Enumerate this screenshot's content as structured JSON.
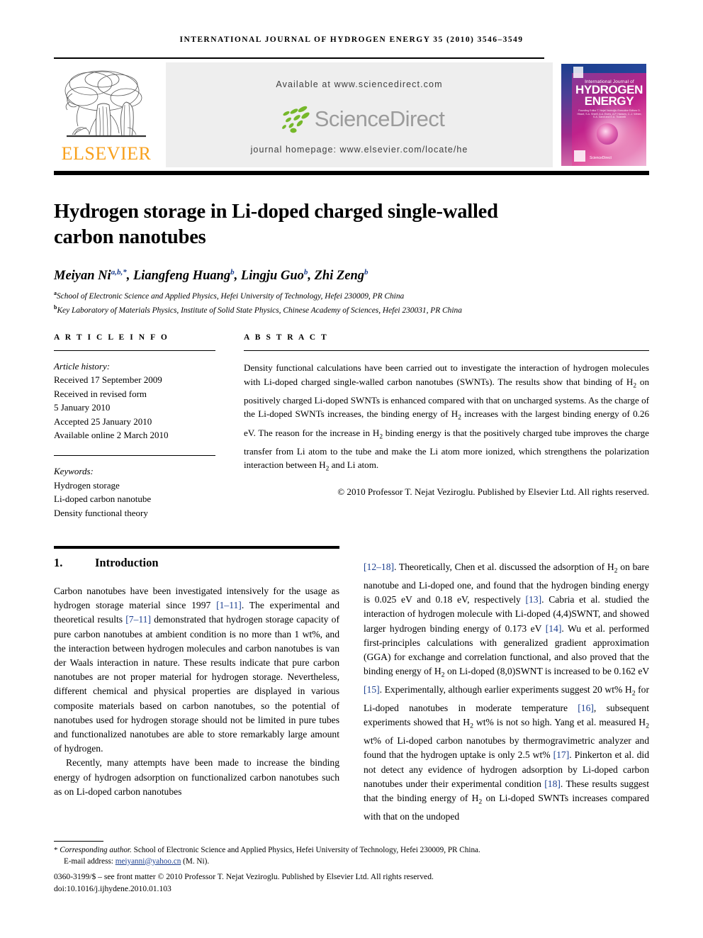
{
  "running_head": "INTERNATIONAL JOURNAL OF HYDROGEN ENERGY 35 (2010) 3546–3549",
  "masthead": {
    "publisher_name": "ELSEVIER",
    "available_at": "Available at www.sciencedirect.com",
    "sciencedirect_wordmark": "ScienceDirect",
    "journal_homepage": "journal homepage: www.elsevier.com/locate/he",
    "cover": {
      "line1": "International Journal of",
      "line2": "HYDROGEN",
      "line3": "ENERGY",
      "editors": "Founding Editor   T. Nejat Veziroğlu\nExecutive Editors   D. Hissel, S.A. Sherif, A.A. Evers, A.P. Hansen, C.-J. Winter, S.A. Gardi and E.A. Ticianelli",
      "sciencedirect": "ScienceDirect"
    }
  },
  "article": {
    "title": "Hydrogen storage in Li-doped charged single-walled carbon nanotubes",
    "authors": [
      {
        "name": "Meiyan Ni",
        "marks": "a,b,*"
      },
      {
        "name": "Liangfeng Huang",
        "marks": "b"
      },
      {
        "name": "Lingju Guo",
        "marks": "b"
      },
      {
        "name": "Zhi Zeng",
        "marks": "b"
      }
    ],
    "affiliations": [
      {
        "mark": "a",
        "text": "School of Electronic Science and Applied Physics, Hefei University of Technology, Hefei 230009, PR China"
      },
      {
        "mark": "b",
        "text": "Key Laboratory of Materials Physics, Institute of Solid State Physics, Chinese Academy of Sciences, Hefei 230031, PR China"
      }
    ]
  },
  "article_info": {
    "heading": "A R T I C L E   I N F O",
    "history_label": "Article history:",
    "history": [
      "Received 17 September 2009",
      "Received in revised form",
      "5 January 2010",
      "Accepted 25 January 2010",
      "Available online 2 March 2010"
    ],
    "keywords_label": "Keywords:",
    "keywords": [
      "Hydrogen storage",
      "Li-doped carbon nanotube",
      "Density functional theory"
    ]
  },
  "abstract": {
    "heading": "A B S T R A C T",
    "text_parts": [
      "Density functional calculations have been carried out to investigate the interaction of hydrogen molecules with Li-doped charged single-walled carbon nanotubes (SWNTs). The results show that binding of H",
      "2",
      " on positively charged Li-doped SWNTs is enhanced compared with that on uncharged systems. As the charge of the Li-doped SWNTs increases, the binding energy of H",
      "2",
      " increases with the largest binding energy of 0.26 eV. The reason for the increase in H",
      "2",
      " binding energy is that the positively charged tube improves the charge transfer from Li atom to the tube and make the Li atom more ionized, which strengthens the polarization interaction between H",
      "2",
      " and Li atom."
    ],
    "copyright": "© 2010 Professor T. Nejat Veziroglu. Published by Elsevier Ltd. All rights reserved."
  },
  "body": {
    "section_number": "1.",
    "section_title": "Introduction",
    "left_paragraph_1": "Carbon nanotubes have been investigated intensively for the usage as hydrogen storage material since 1997 [1–11]. The experimental and theoretical results [7–11] demonstrated that hydrogen storage capacity of pure carbon nanotubes at ambient condition is no more than 1 wt%, and the interaction between hydrogen molecules and carbon nanotubes is van der Waals interaction in nature. These results indicate that pure carbon nanotubes are not proper material for hydrogen storage. Nevertheless, different chemical and physical properties are displayed in various composite materials based on carbon nanotubes, so the potential of nanotubes used for hydrogen storage should not be limited in pure tubes and functionalized nanotubes are able to store remarkably large amount of hydrogen.",
    "left_paragraph_2": "Recently, many attempts have been made to increase the binding energy of hydrogen adsorption on functionalized carbon nanotubes such as on Li-doped carbon nanotubes",
    "right_paragraph": "[12–18]. Theoretically, Chen et al. discussed the adsorption of H2 on bare nanotube and Li-doped one, and found that the hydrogen binding energy is 0.025 eV and 0.18 eV, respectively [13]. Cabria et al. studied the interaction of hydrogen molecule with Li-doped (4,4)SWNT, and showed larger hydrogen binding energy of 0.173 eV [14]. Wu et al. performed first-principles calculations with generalized gradient approximation (GGA) for exchange and correlation functional, and also proved that the binding energy of H2 on Li-doped (8,0)SWNT is increased to be 0.162 eV [15]. Experimentally, although earlier experiments suggest 20 wt% H2 for Li-doped nanotubes in moderate temperature [16], subsequent experiments showed that H2 wt% is not so high. Yang et al. measured H2 wt% of Li-doped carbon nanotubes by thermogravimetric analyzer and found that the hydrogen uptake is only 2.5 wt% [17]. Pinkerton et al. did not detect any evidence of hydrogen adsorption by Li-doped carbon nanotubes under their experimental condition [18]. These results suggest that the binding energy of H2 on Li-doped SWNTs increases compared with that on the undoped",
    "citation_refs": [
      "[1–11]",
      "[7–11]",
      "[12–18]",
      "[13]",
      "[14]",
      "[15]",
      "[16]",
      "[17]",
      "[18]"
    ]
  },
  "footer": {
    "corresponding_marker": "*",
    "corresponding_text": "Corresponding author.",
    "corresponding_address": " School of Electronic Science and Applied Physics, Hefei University of Technology, Hefei 230009, PR China.",
    "email_label": "E-mail address:",
    "email": "meiyanni@yahoo.cn",
    "email_suffix": "(M. Ni).",
    "issn_line": "0360-3199/$ – see front matter © 2010 Professor T. Nejat Veziroglu. Published by Elsevier Ltd. All rights reserved.",
    "doi_line": "doi:10.1016/j.ijhydene.2010.01.103"
  },
  "colors": {
    "elsevier_orange": "#f8a01c",
    "link_blue": "#1c3f8f",
    "sciencedirect_green": "#76b82a",
    "sciencedirect_gray": "#9b9b9b",
    "banner_gray": "#eeeeee"
  }
}
